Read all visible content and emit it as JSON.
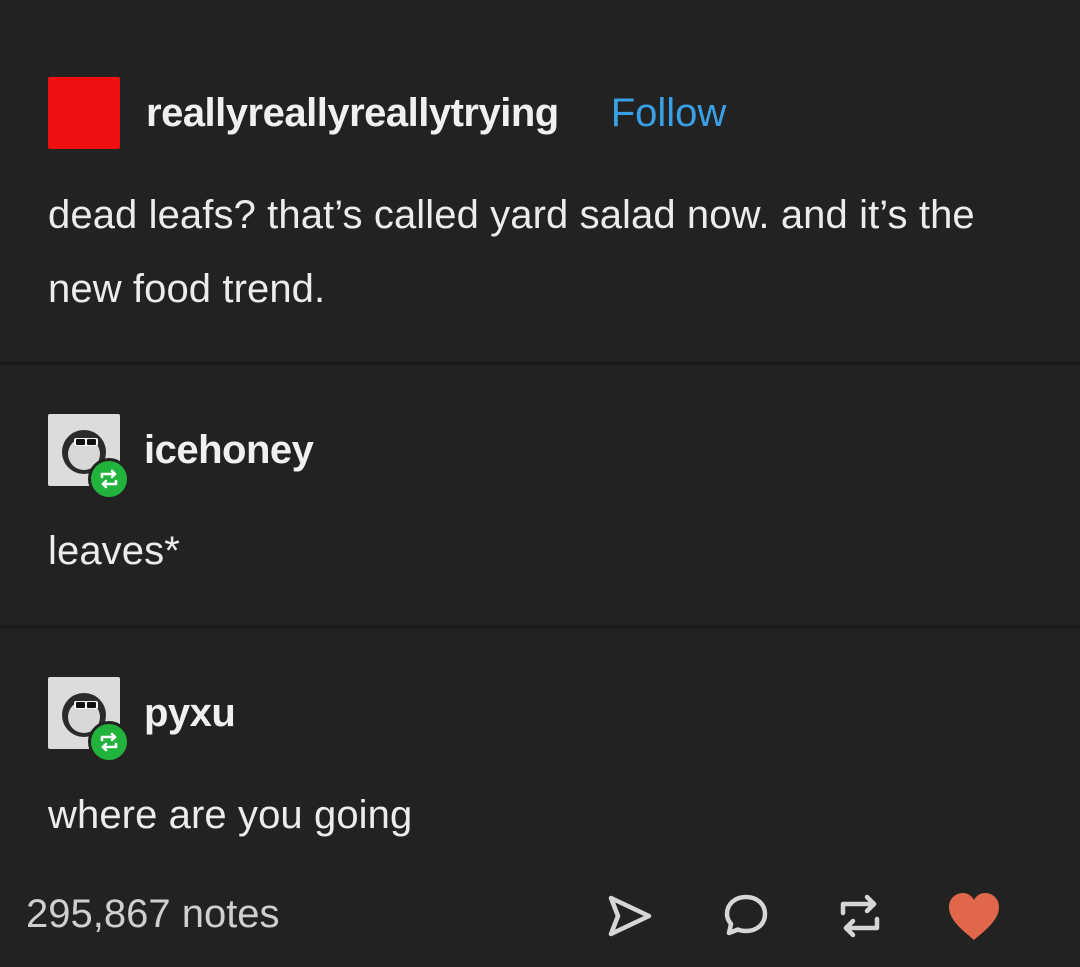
{
  "post": {
    "author": "reallyreallyreallytrying",
    "follow_label": "Follow",
    "text": "dead leafs? that’s called yard salad now. and it’s the new food trend.",
    "accent_colors": {
      "follow": "#3aa0e6",
      "avatar": "#ee1010",
      "reblog_badge": "#22b33c",
      "like": "#e0674a"
    }
  },
  "reblogs": [
    {
      "user": "icehoney",
      "text": "leaves*",
      "avatar_icon": "sunglasses-face-icon",
      "badge_icon": "reblog-icon"
    },
    {
      "user": "pyxu",
      "text": "where are you going",
      "avatar_icon": "sunglasses-face-icon",
      "badge_icon": "reblog-icon"
    }
  ],
  "footer": {
    "notes": "295,867 notes",
    "actions": [
      "share-icon",
      "reply-icon",
      "reblog-icon",
      "like-heart-icon"
    ]
  }
}
